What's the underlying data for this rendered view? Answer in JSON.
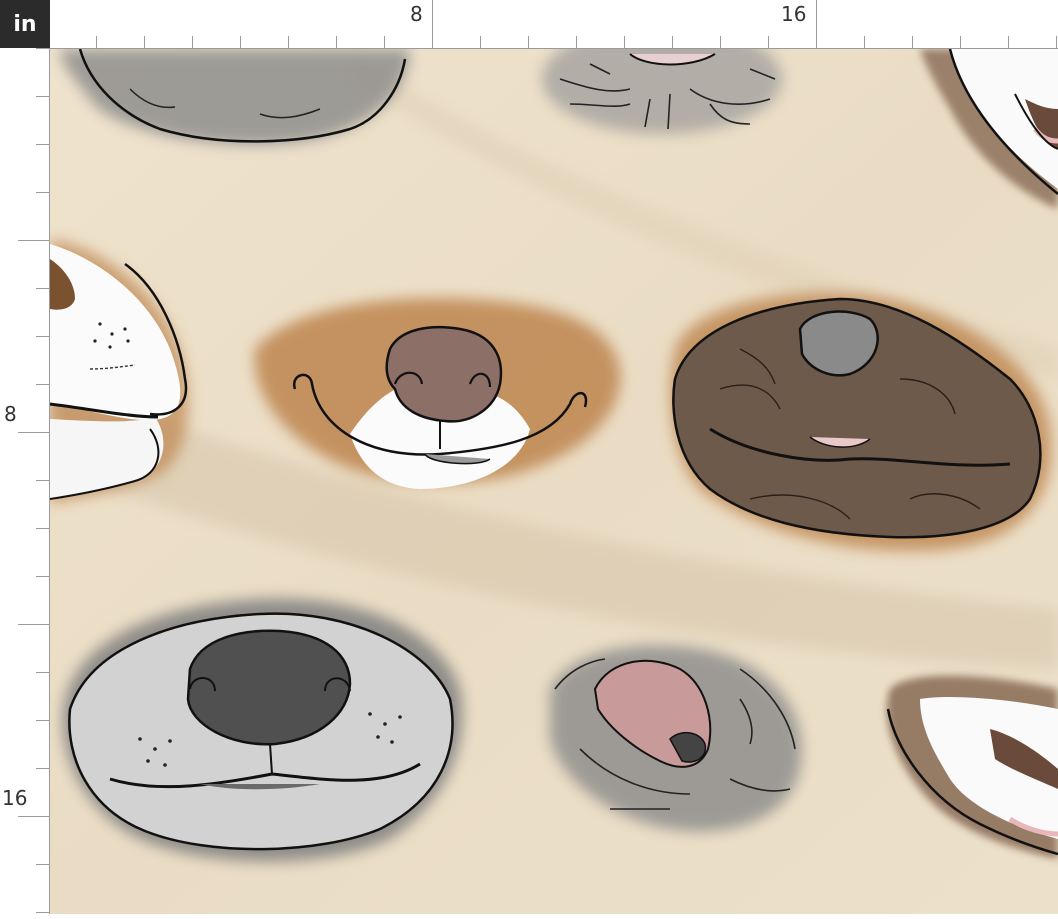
{
  "ruler": {
    "unit_label": "in",
    "top_labels": [
      "8",
      "16"
    ],
    "left_labels": [
      "8",
      "16"
    ]
  },
  "fabric": {
    "background_color": "#efe3cd",
    "motifs": [
      "gray-muzzle-top-left",
      "gray-wrinkled-muzzle-top-center",
      "white-muzzle-top-right",
      "white-brown-muzzle-left",
      "tan-muzzle-center",
      "brown-wrinkled-muzzle-right",
      "gray-muzzle-bottom-left",
      "pink-nose-wrinkled-muzzle-bottom-center",
      "white-brown-muzzle-bottom-right"
    ]
  }
}
